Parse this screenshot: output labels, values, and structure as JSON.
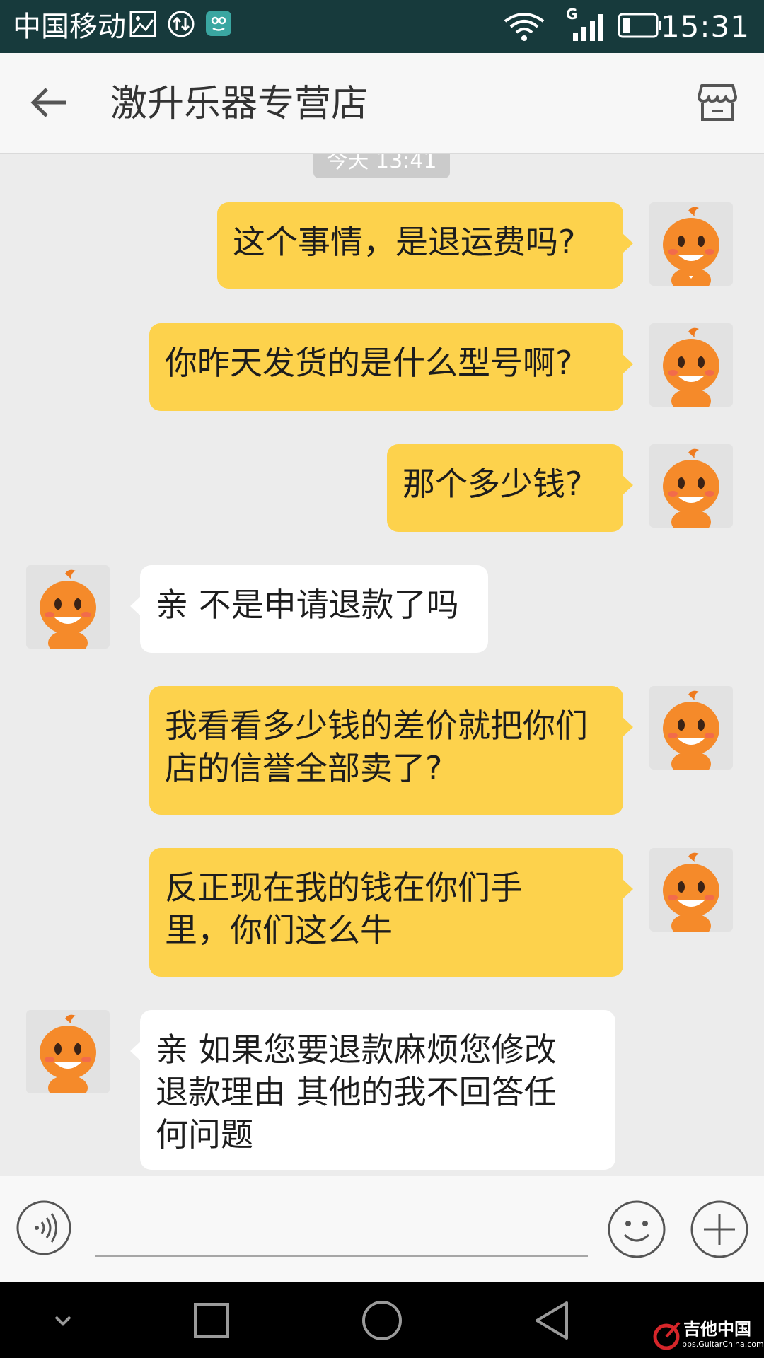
{
  "status_bar": {
    "carrier": "中国移动",
    "network_type": "G",
    "time": "15:31",
    "icons": [
      "image-icon",
      "data-transfer-icon",
      "app-notification-icon",
      "wifi-icon",
      "signal-icon",
      "battery-icon"
    ]
  },
  "header": {
    "title": "激升乐器专营店",
    "icons": [
      "back-arrow-icon",
      "store-icon"
    ]
  },
  "chat": {
    "timestamp": "今天 13:41",
    "messages": [
      {
        "side": "out",
        "text": "这个事情，是退运费吗?"
      },
      {
        "side": "out",
        "text": "你昨天发货的是什么型号啊?"
      },
      {
        "side": "out",
        "text": "那个多少钱?"
      },
      {
        "side": "in",
        "text": "亲 不是申请退款了吗"
      },
      {
        "side": "out",
        "line1": "我看看多少钱的差价就把你们",
        "line2": "店的信誉全部卖了?"
      },
      {
        "side": "out",
        "line1": "反正现在我的钱在你们手",
        "line2": "里，你们这么牛"
      },
      {
        "side": "in",
        "line1": "亲 如果您要退款麻烦您修改",
        "line2": "退款理由 其他的我不回答任",
        "line3": "何问题"
      }
    ]
  },
  "input_bar": {
    "placeholder": "",
    "icons": [
      "voice-icon",
      "emoji-icon",
      "plus-icon"
    ]
  },
  "nav_bar": {
    "icons": [
      "chevron-down-icon",
      "recent-apps-icon",
      "home-icon",
      "back-icon"
    ]
  },
  "watermark": {
    "title": "吉他中国",
    "url": "bbs.GuitarChina.com"
  },
  "colors": {
    "status_bar": "#173a3c",
    "outgoing_bubble": "#fdd24c",
    "incoming_bubble": "#ffffff",
    "chat_background": "#ececec"
  }
}
